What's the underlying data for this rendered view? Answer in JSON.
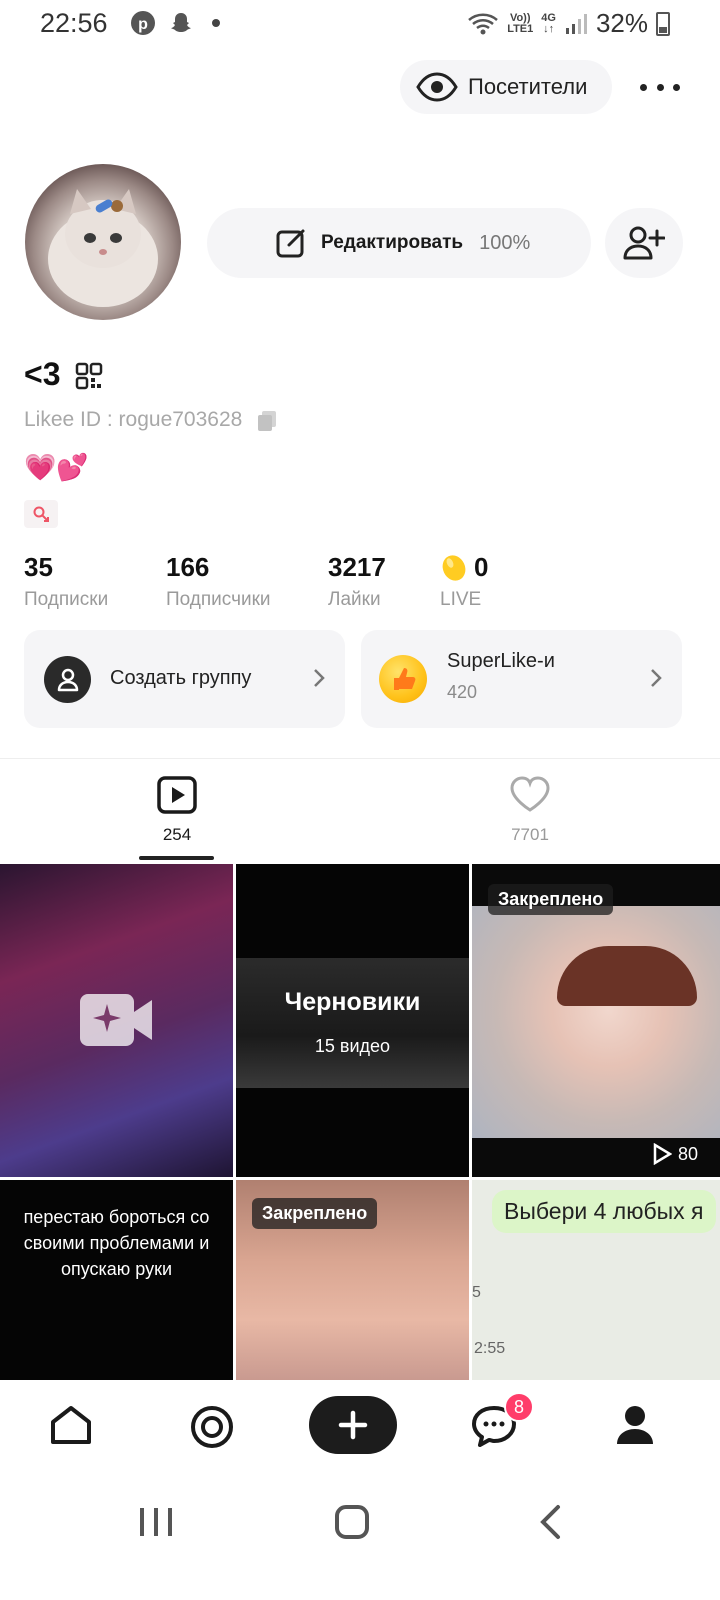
{
  "status_bar": {
    "time": "22:56",
    "network_top": "Vo))",
    "network_bottom": "LTE1",
    "network_type": "4G",
    "battery": "32%"
  },
  "header": {
    "visitors_label": "Посетители"
  },
  "profile": {
    "edit_label": "Редактировать",
    "edit_percent": "100%",
    "nickname": "<3",
    "likee_id": "Likee ID : rogue703628",
    "bio": "💗💕"
  },
  "stats": [
    {
      "value": "35",
      "label": "Подписки"
    },
    {
      "value": "166",
      "label": "Подписчики"
    },
    {
      "value": "3217",
      "label": "Лайки"
    },
    {
      "value": "0",
      "label": "LIVE"
    }
  ],
  "cards": {
    "group_label": "Создать группу",
    "superlike_title": "SuperLike-и",
    "superlike_count": "420"
  },
  "tabs": {
    "videos_count": "254",
    "likes_count": "7701"
  },
  "grid": {
    "drafts_title": "Черновики",
    "drafts_sub": "15 видео",
    "pinned_label": "Закреплено",
    "tile3_plays": "80",
    "tile4_text": "перестаю бороться со своими проблемами и опускаю руки",
    "tile6_bubble": "Выбери 4 любых я",
    "tile6_num1": "5",
    "tile6_num2": "2:55"
  },
  "nav": {
    "messages_badge": "8"
  },
  "colors": {
    "accent_pink": "#ff3d6a",
    "card_bg": "#f5f5f7"
  }
}
